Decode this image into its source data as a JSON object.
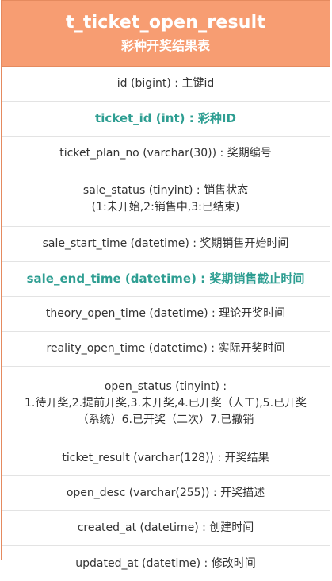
{
  "table": {
    "title": "t_ticket_open_result",
    "subtitle": "彩种开奖结果表",
    "fields": [
      {
        "lines": [
          "id (bigint) : 主键id"
        ],
        "key": false
      },
      {
        "lines": [
          "ticket_id (int) : 彩种ID"
        ],
        "key": true
      },
      {
        "lines": [
          "ticket_plan_no (varchar(30)) : 奖期编号"
        ],
        "key": false
      },
      {
        "lines": [
          "sale_status (tinyint) : 销售状态",
          "(1:未开始,2:销售中,3:已结束)"
        ],
        "key": false
      },
      {
        "lines": [
          "sale_start_time (datetime) : 奖期销售开始时间"
        ],
        "key": false
      },
      {
        "lines": [
          "sale_end_time (datetime) : 奖期销售截止时间"
        ],
        "key": true
      },
      {
        "lines": [
          "theory_open_time (datetime) : 理论开奖时间"
        ],
        "key": false
      },
      {
        "lines": [
          "reality_open_time (datetime) : 实际开奖时间"
        ],
        "key": false
      },
      {
        "lines": [
          "open_status (tinyint) :",
          "1.待开奖,2.提前开奖,3.未开奖,4.已开奖（人工),5.已开奖",
          "（系统）6.已开奖（二次）7.已撤销"
        ],
        "key": false
      },
      {
        "lines": [
          "ticket_result (varchar(128)) : 开奖结果"
        ],
        "key": false
      },
      {
        "lines": [
          "open_desc (varchar(255)) : 开奖描述"
        ],
        "key": false
      },
      {
        "lines": [
          "created_at (datetime) : 创建时间"
        ],
        "key": false
      },
      {
        "lines": [
          "updated_at (datetime) : 修改时间"
        ],
        "key": false
      }
    ]
  }
}
